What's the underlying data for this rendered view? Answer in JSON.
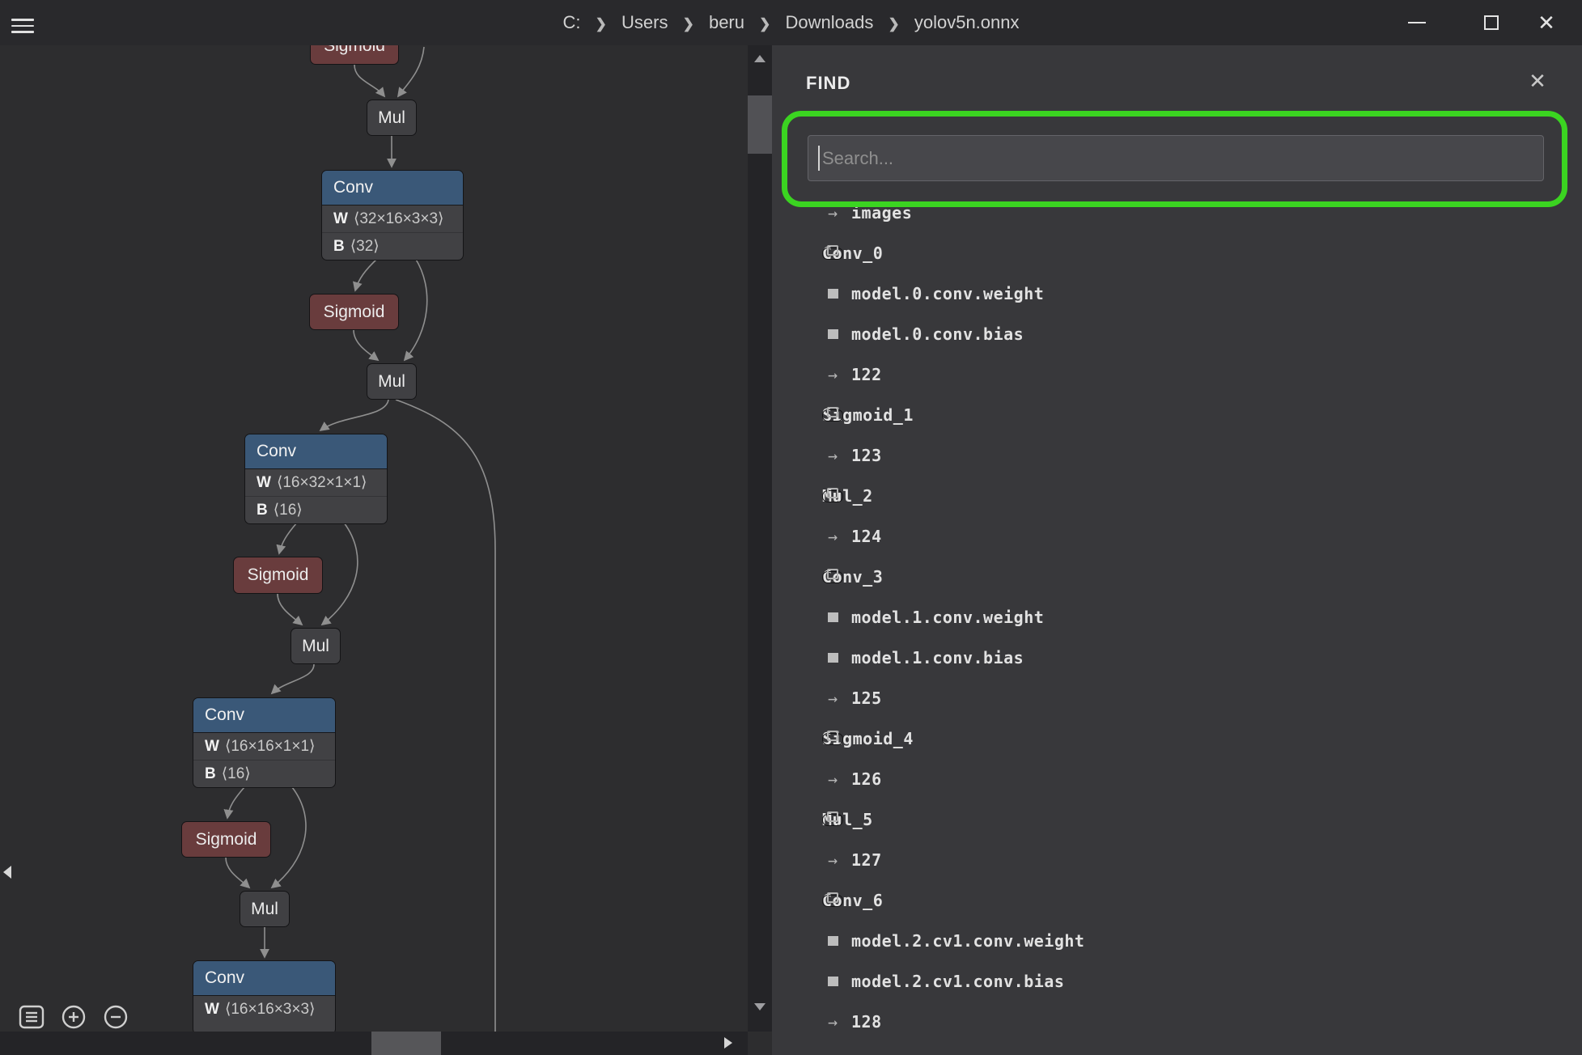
{
  "window": {
    "breadcrumb": [
      "C:",
      "Users",
      "beru",
      "Downloads",
      "yolov5n.onnx"
    ],
    "chevron": "❯",
    "close_glyph": "✕"
  },
  "find_panel": {
    "title": "FIND",
    "close_glyph": "✕",
    "search": {
      "placeholder": "Search...",
      "value": ""
    },
    "items": [
      {
        "type": "arrow",
        "label": "images"
      },
      {
        "type": "node",
        "label": "Conv_0"
      },
      {
        "type": "weight",
        "label": "model.0.conv.weight"
      },
      {
        "type": "weight",
        "label": "model.0.conv.bias"
      },
      {
        "type": "arrow",
        "label": "122"
      },
      {
        "type": "node",
        "label": "Sigmoid_1"
      },
      {
        "type": "arrow",
        "label": "123"
      },
      {
        "type": "node",
        "label": "Mul_2"
      },
      {
        "type": "arrow",
        "label": "124"
      },
      {
        "type": "node",
        "label": "Conv_3"
      },
      {
        "type": "weight",
        "label": "model.1.conv.weight"
      },
      {
        "type": "weight",
        "label": "model.1.conv.bias"
      },
      {
        "type": "arrow",
        "label": "125"
      },
      {
        "type": "node",
        "label": "Sigmoid_4"
      },
      {
        "type": "arrow",
        "label": "126"
      },
      {
        "type": "node",
        "label": "Mul_5"
      },
      {
        "type": "arrow",
        "label": "127"
      },
      {
        "type": "node",
        "label": "Conv_6"
      },
      {
        "type": "weight",
        "label": "model.2.cv1.conv.weight"
      },
      {
        "type": "weight",
        "label": "model.2.cv1.conv.bias"
      },
      {
        "type": "arrow",
        "label": "128"
      }
    ]
  },
  "graph": {
    "nodes": [
      {
        "label": "Sigmoid"
      },
      {
        "label": "Mul"
      },
      {
        "label": "Conv",
        "params": [
          {
            "name": "W",
            "dims": "⟨32×16×3×3⟩"
          },
          {
            "name": "B",
            "dims": "⟨32⟩"
          }
        ]
      },
      {
        "label": "Sigmoid"
      },
      {
        "label": "Mul"
      },
      {
        "label": "Conv",
        "params": [
          {
            "name": "W",
            "dims": "⟨16×32×1×1⟩"
          },
          {
            "name": "B",
            "dims": "⟨16⟩"
          }
        ]
      },
      {
        "label": "Sigmoid"
      },
      {
        "label": "Mul"
      },
      {
        "label": "Conv",
        "params": [
          {
            "name": "W",
            "dims": "⟨16×16×1×1⟩"
          },
          {
            "name": "B",
            "dims": "⟨16⟩"
          }
        ]
      },
      {
        "label": "Sigmoid"
      },
      {
        "label": "Mul"
      },
      {
        "label": "Conv",
        "params": [
          {
            "name": "W",
            "dims": "⟨16×16×3×3⟩"
          }
        ]
      }
    ]
  },
  "colors": {
    "highlight_green": "#3bd421",
    "conv_header_blue": "#3a5878",
    "sigmoid_red": "#693c3d",
    "mul_gray": "#404043",
    "canvas_bg": "#2d2d2f",
    "panel_bg": "#38383b"
  }
}
